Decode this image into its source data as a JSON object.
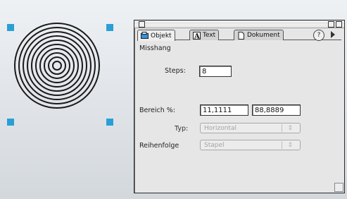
{
  "tabs": [
    {
      "label": "Objekt",
      "icon": "object-icon",
      "active": true
    },
    {
      "label": "Text",
      "icon": "text-icon",
      "active": false
    },
    {
      "label": "Dokument",
      "icon": "document-icon",
      "active": false
    }
  ],
  "section": {
    "title": "Misshang"
  },
  "steps": {
    "label": "Steps:",
    "value": "8"
  },
  "bereich": {
    "label": "Bereich %:",
    "from": "11,1111",
    "to": "88,8889"
  },
  "typ": {
    "label": "Typ:",
    "value": "Horizontal"
  },
  "reihenfolge": {
    "label": "Reihenfolge",
    "value": "Stapel"
  },
  "help": {
    "symbol": "?"
  },
  "colors": {
    "handle": "#2a9fd6",
    "panel": "#e6e6e6"
  }
}
